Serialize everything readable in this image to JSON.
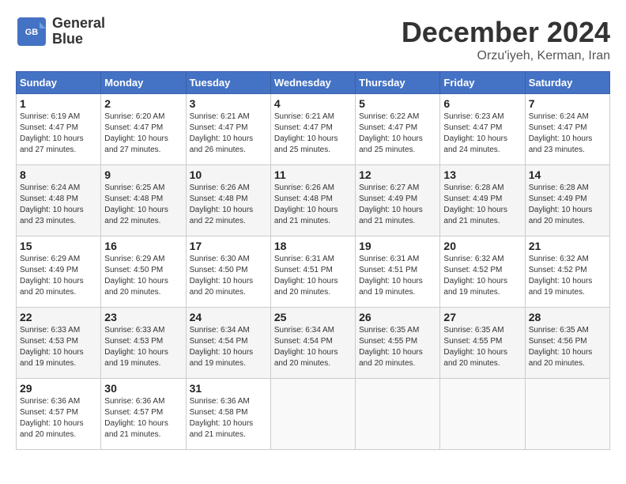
{
  "header": {
    "logo_line1": "General",
    "logo_line2": "Blue",
    "month": "December 2024",
    "location": "Orzu'iyeh, Kerman, Iran"
  },
  "weekdays": [
    "Sunday",
    "Monday",
    "Tuesday",
    "Wednesday",
    "Thursday",
    "Friday",
    "Saturday"
  ],
  "weeks": [
    [
      {
        "day": "1",
        "info": "Sunrise: 6:19 AM\nSunset: 4:47 PM\nDaylight: 10 hours\nand 27 minutes."
      },
      {
        "day": "2",
        "info": "Sunrise: 6:20 AM\nSunset: 4:47 PM\nDaylight: 10 hours\nand 27 minutes."
      },
      {
        "day": "3",
        "info": "Sunrise: 6:21 AM\nSunset: 4:47 PM\nDaylight: 10 hours\nand 26 minutes."
      },
      {
        "day": "4",
        "info": "Sunrise: 6:21 AM\nSunset: 4:47 PM\nDaylight: 10 hours\nand 25 minutes."
      },
      {
        "day": "5",
        "info": "Sunrise: 6:22 AM\nSunset: 4:47 PM\nDaylight: 10 hours\nand 25 minutes."
      },
      {
        "day": "6",
        "info": "Sunrise: 6:23 AM\nSunset: 4:47 PM\nDaylight: 10 hours\nand 24 minutes."
      },
      {
        "day": "7",
        "info": "Sunrise: 6:24 AM\nSunset: 4:47 PM\nDaylight: 10 hours\nand 23 minutes."
      }
    ],
    [
      {
        "day": "8",
        "info": "Sunrise: 6:24 AM\nSunset: 4:48 PM\nDaylight: 10 hours\nand 23 minutes."
      },
      {
        "day": "9",
        "info": "Sunrise: 6:25 AM\nSunset: 4:48 PM\nDaylight: 10 hours\nand 22 minutes."
      },
      {
        "day": "10",
        "info": "Sunrise: 6:26 AM\nSunset: 4:48 PM\nDaylight: 10 hours\nand 22 minutes."
      },
      {
        "day": "11",
        "info": "Sunrise: 6:26 AM\nSunset: 4:48 PM\nDaylight: 10 hours\nand 21 minutes."
      },
      {
        "day": "12",
        "info": "Sunrise: 6:27 AM\nSunset: 4:49 PM\nDaylight: 10 hours\nand 21 minutes."
      },
      {
        "day": "13",
        "info": "Sunrise: 6:28 AM\nSunset: 4:49 PM\nDaylight: 10 hours\nand 21 minutes."
      },
      {
        "day": "14",
        "info": "Sunrise: 6:28 AM\nSunset: 4:49 PM\nDaylight: 10 hours\nand 20 minutes."
      }
    ],
    [
      {
        "day": "15",
        "info": "Sunrise: 6:29 AM\nSunset: 4:49 PM\nDaylight: 10 hours\nand 20 minutes."
      },
      {
        "day": "16",
        "info": "Sunrise: 6:29 AM\nSunset: 4:50 PM\nDaylight: 10 hours\nand 20 minutes."
      },
      {
        "day": "17",
        "info": "Sunrise: 6:30 AM\nSunset: 4:50 PM\nDaylight: 10 hours\nand 20 minutes."
      },
      {
        "day": "18",
        "info": "Sunrise: 6:31 AM\nSunset: 4:51 PM\nDaylight: 10 hours\nand 20 minutes."
      },
      {
        "day": "19",
        "info": "Sunrise: 6:31 AM\nSunset: 4:51 PM\nDaylight: 10 hours\nand 19 minutes."
      },
      {
        "day": "20",
        "info": "Sunrise: 6:32 AM\nSunset: 4:52 PM\nDaylight: 10 hours\nand 19 minutes."
      },
      {
        "day": "21",
        "info": "Sunrise: 6:32 AM\nSunset: 4:52 PM\nDaylight: 10 hours\nand 19 minutes."
      }
    ],
    [
      {
        "day": "22",
        "info": "Sunrise: 6:33 AM\nSunset: 4:53 PM\nDaylight: 10 hours\nand 19 minutes."
      },
      {
        "day": "23",
        "info": "Sunrise: 6:33 AM\nSunset: 4:53 PM\nDaylight: 10 hours\nand 19 minutes."
      },
      {
        "day": "24",
        "info": "Sunrise: 6:34 AM\nSunset: 4:54 PM\nDaylight: 10 hours\nand 19 minutes."
      },
      {
        "day": "25",
        "info": "Sunrise: 6:34 AM\nSunset: 4:54 PM\nDaylight: 10 hours\nand 20 minutes."
      },
      {
        "day": "26",
        "info": "Sunrise: 6:35 AM\nSunset: 4:55 PM\nDaylight: 10 hours\nand 20 minutes."
      },
      {
        "day": "27",
        "info": "Sunrise: 6:35 AM\nSunset: 4:55 PM\nDaylight: 10 hours\nand 20 minutes."
      },
      {
        "day": "28",
        "info": "Sunrise: 6:35 AM\nSunset: 4:56 PM\nDaylight: 10 hours\nand 20 minutes."
      }
    ],
    [
      {
        "day": "29",
        "info": "Sunrise: 6:36 AM\nSunset: 4:57 PM\nDaylight: 10 hours\nand 20 minutes."
      },
      {
        "day": "30",
        "info": "Sunrise: 6:36 AM\nSunset: 4:57 PM\nDaylight: 10 hours\nand 21 minutes."
      },
      {
        "day": "31",
        "info": "Sunrise: 6:36 AM\nSunset: 4:58 PM\nDaylight: 10 hours\nand 21 minutes."
      },
      {
        "day": "",
        "info": ""
      },
      {
        "day": "",
        "info": ""
      },
      {
        "day": "",
        "info": ""
      },
      {
        "day": "",
        "info": ""
      }
    ]
  ]
}
